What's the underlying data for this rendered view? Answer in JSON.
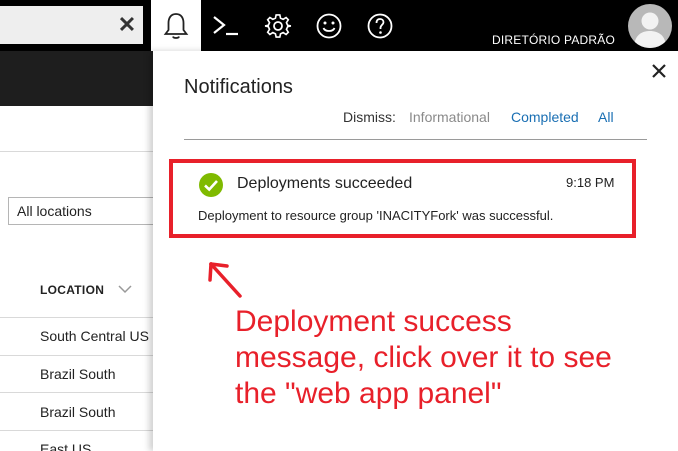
{
  "topbar": {
    "search_clear_symbol": "✕",
    "buttons": [
      {
        "name": "notifications-bell-icon",
        "active": true
      },
      {
        "name": "cloud-shell-icon",
        "active": false
      },
      {
        "name": "settings-gear-icon",
        "active": false
      },
      {
        "name": "feedback-smiley-icon",
        "active": false
      },
      {
        "name": "help-question-icon",
        "active": false
      }
    ],
    "directory": "DIRETÓRIO PADRÃO"
  },
  "background": {
    "location_filter": "All locations",
    "location_header": "LOCATION",
    "locations": [
      "South Central US",
      "Brazil South",
      "Brazil South",
      "East US"
    ]
  },
  "notifications": {
    "title": "Notifications",
    "dismiss_label": "Dismiss:",
    "dismiss_informational": "Informational",
    "dismiss_completed": "Completed",
    "dismiss_all": "All",
    "item": {
      "title": "Deployments succeeded",
      "time": "9:18 PM",
      "message": "Deployment to resource group 'INACITYFork' was successful.",
      "status": "success"
    }
  },
  "annotation": {
    "lines": [
      "Deployment success",
      "message, click over it to see",
      "the \"web app panel\""
    ]
  },
  "colors": {
    "topbar": "#000000",
    "accent_link": "#1a6fb3",
    "success_green": "#7fba00",
    "highlight_red": "#e8202a"
  }
}
